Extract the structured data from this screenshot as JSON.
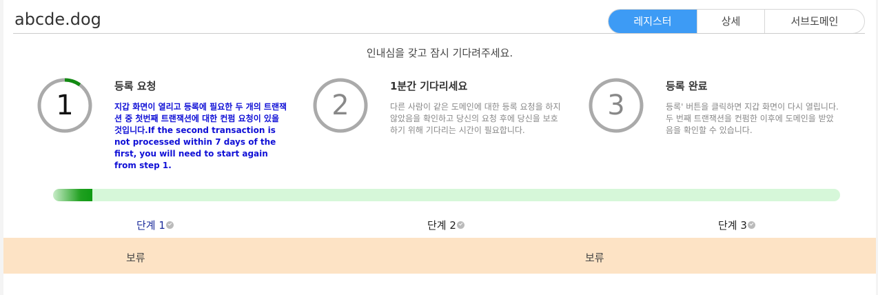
{
  "header": {
    "domain": "abcde.dog"
  },
  "tabs": [
    {
      "label": "레지스터",
      "active": true
    },
    {
      "label": "상세",
      "active": false
    },
    {
      "label": "서브도메인",
      "active": false
    }
  ],
  "wait_message": "인내심을 갖고 잠시 기다려주세요.",
  "steps": [
    {
      "number": "1",
      "title": "등록 요청",
      "desc": "지갑 화면이 열리고 등록에 필요한 두 개의 트랜잭션 중 첫번째 트랜잭션에 대한 컨펌 요청이 있을 것입니다.If the second transaction is not processed within 7 days of the first, you will need to start again from step 1.",
      "active": true,
      "progress": 0.1
    },
    {
      "number": "2",
      "title": "1분간 기다리세요",
      "desc": "다른 사람이 같은 도메인에 대한 등록 요청을 하지 않았음을 확인하고 당신의 요청 후에 당신을 보호하기 위해 기다리는 시간이 필요합니다.",
      "active": false,
      "progress": 1
    },
    {
      "number": "3",
      "title": "등록 완료",
      "desc": "등록' 버튼을 클릭하면 지갑 화면이 다시 열립니다. 두 번째 트랜잭션을 컨펌한 이후에 도메인을 받았음을 확인할 수 있습니다.",
      "active": false,
      "progress": 1
    }
  ],
  "progress": {
    "fraction": 0.05,
    "fill_color": "#0f9a14",
    "track_color": "#d6f7d9"
  },
  "step_labels": [
    "단계 1",
    "단계 2",
    "단계 3"
  ],
  "status": [
    "보류",
    "보류"
  ],
  "colors": {
    "accent": "#3d9bf5",
    "status_bg": "#fde3c5",
    "active_text": "#1010d6"
  }
}
